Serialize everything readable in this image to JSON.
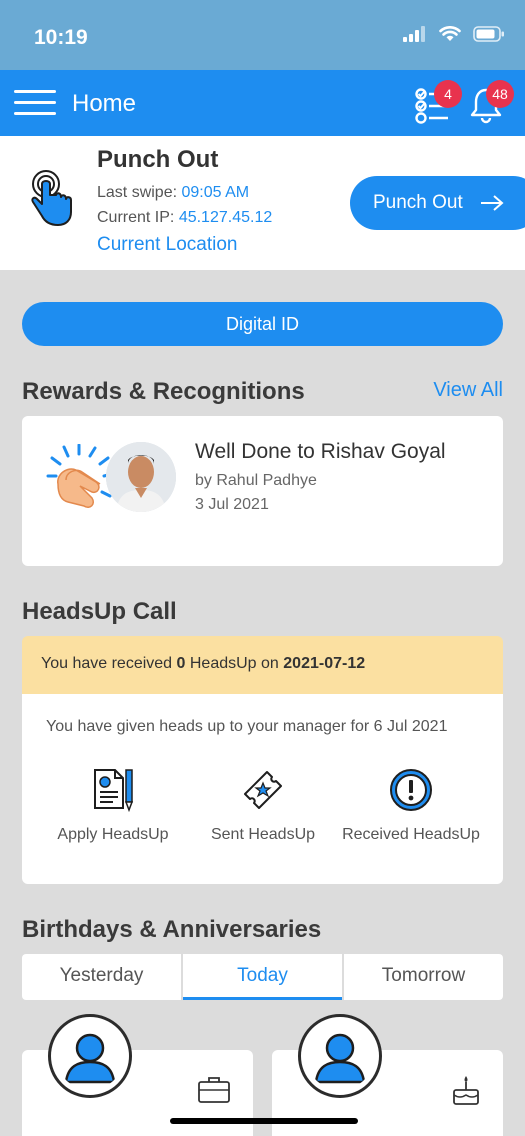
{
  "status": {
    "time": "10:19"
  },
  "appbar": {
    "title": "Home",
    "tasks_badge": "4",
    "notif_badge": "48"
  },
  "punch": {
    "title": "Punch Out",
    "last_swipe_label": "Last swipe:",
    "last_swipe_value": "09:05 AM",
    "ip_label": "Current IP:",
    "ip_value": "45.127.45.12",
    "location_link": "Current Location",
    "button_label": "Punch Out"
  },
  "digital_id": {
    "label": "Digital ID"
  },
  "rewards": {
    "title": "Rewards & Recognitions",
    "view_all": "View All",
    "item": {
      "title": "Well Done to Rishav Goyal",
      "by": "by Rahul Padhye",
      "date": "3 Jul 2021"
    }
  },
  "headsup": {
    "title": "HeadsUp Call",
    "banner": {
      "pre": "You have received ",
      "count": "0",
      "mid": " HeadsUp on ",
      "date": "2021-07-12"
    },
    "given": "You have given heads up to your manager for 6 Jul 2021",
    "actions": [
      {
        "label": "Apply HeadsUp",
        "icon": "document-pen-icon"
      },
      {
        "label": "Sent HeadsUp",
        "icon": "ticket-star-icon"
      },
      {
        "label": "Received HeadsUp",
        "icon": "alert-clock-icon"
      }
    ]
  },
  "birthdays": {
    "title": "Birthdays & Anniversaries",
    "tabs": [
      "Yesterday",
      "Today",
      "Tomorrow"
    ],
    "active_tab": "Today"
  },
  "colors": {
    "primary": "#1e8df0",
    "banner": "#fbe0a1",
    "badge": "#e8334e"
  }
}
